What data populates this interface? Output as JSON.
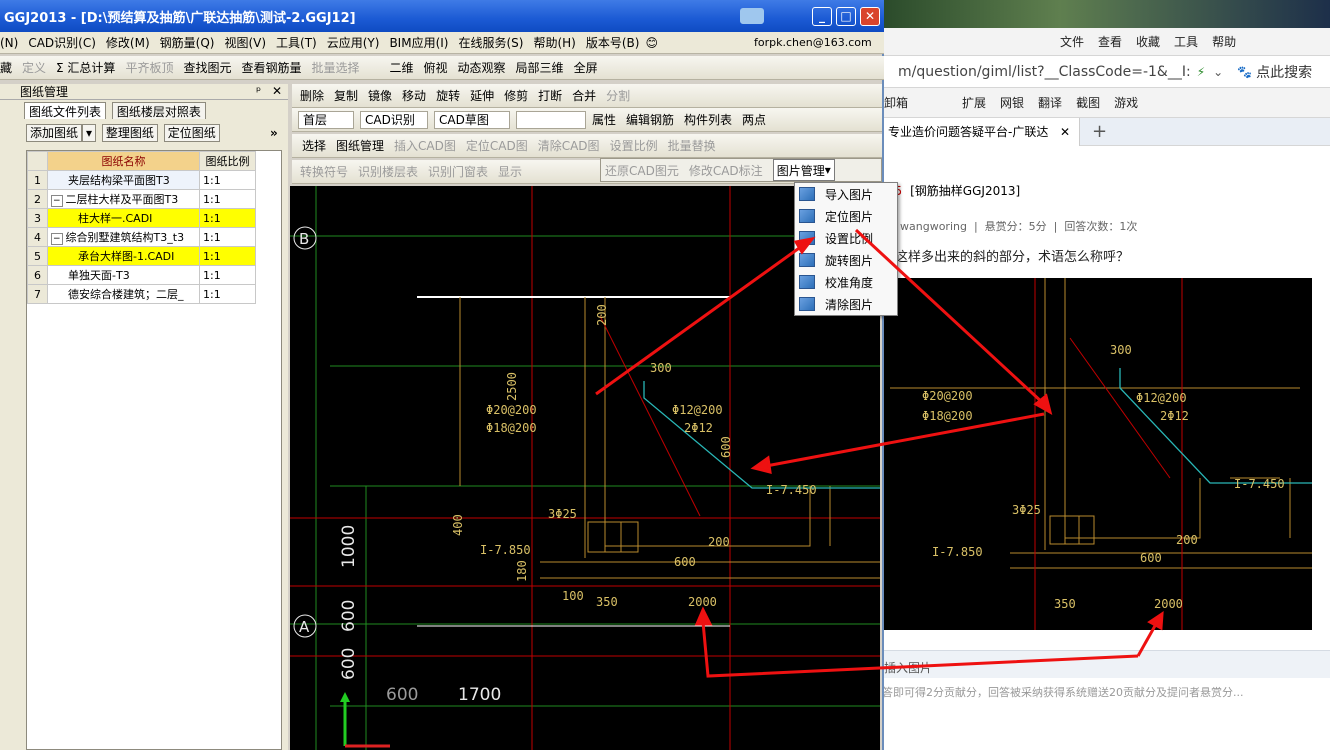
{
  "app": {
    "title": "GGJ2013 - [D:\\预结算及抽筋\\广联达抽筋\\测试-2.GGJ12]",
    "account": "forpk.chen@163.com"
  },
  "menu": [
    "(N)",
    "CAD识别(C)",
    "修改(M)",
    "钢筋量(Q)",
    "视图(V)",
    "工具(T)",
    "云应用(Y)",
    "BIM应用(I)",
    "在线服务(S)",
    "帮助(H)",
    "版本号(B)"
  ],
  "toolbar1": {
    "left": [
      "藏",
      "定义",
      "Σ 汇总计算",
      "平齐板顶",
      "查找图元",
      "查看钢筋量",
      "批量选择"
    ],
    "right": [
      "二维",
      "俯视",
      "动态观察",
      "局部三维",
      "全屏"
    ]
  },
  "toolbar2": [
    "删除",
    "复制",
    "镜像",
    "移动",
    "旋转",
    "延伸",
    "修剪",
    "打断",
    "合并",
    "分割"
  ],
  "toolbar3": {
    "floor": "首层",
    "mode": "CAD识别",
    "draft": "CAD草图",
    "blank": "",
    "buttons": [
      "属性",
      "编辑钢筋",
      "构件列表",
      "两点"
    ]
  },
  "toolbar4": [
    "选择",
    "图纸管理",
    "插入CAD图",
    "定位CAD图",
    "清除CAD图",
    "设置比例",
    "批量替换"
  ],
  "toolbar5": [
    "转换符号",
    "识别楼层表",
    "识别门窗表",
    "显示",
    "还原CAD图元",
    "修改CAD标注",
    "图片管理"
  ],
  "picture_menu": [
    "导入图片",
    "定位图片",
    "设置比例",
    "旋转图片",
    "校准角度",
    "清除图片"
  ],
  "panel": {
    "title": "图纸管理",
    "tabs": [
      "图纸文件列表",
      "图纸楼层对照表"
    ],
    "buttons": [
      "添加图纸",
      "整理图纸",
      "定位图纸"
    ],
    "columns": [
      "图纸名称",
      "图纸比例"
    ],
    "rows": [
      {
        "n": "1",
        "name": "夹层结构梁平面图T3",
        "scale": "1:1",
        "hl": false
      },
      {
        "n": "2",
        "name": "二层柱大样及平面图T3",
        "scale": "1:1",
        "hl": false
      },
      {
        "n": "3",
        "name": "柱大样一.CADI",
        "scale": "1:1",
        "hl": true
      },
      {
        "n": "4",
        "name": "综合别墅建筑结构T3_t3",
        "scale": "1:1",
        "hl": false
      },
      {
        "n": "5",
        "name": "承台大样图-1.CADI",
        "scale": "1:1",
        "hl": true
      },
      {
        "n": "6",
        "name": "单独天面-T3",
        "scale": "1:1",
        "hl": false
      },
      {
        "n": "7",
        "name": "德安综合楼建筑；二层_",
        "scale": "1:1",
        "hl": false
      }
    ]
  },
  "cad": {
    "axis_b": "B",
    "axis_a": "A",
    "dims": [
      "1000",
      "600",
      "600",
      "600",
      "1700"
    ],
    "labels": [
      "Φ20@200",
      "Φ18@200",
      "Φ12@200",
      "2Φ12",
      "300",
      "600",
      "200",
      "2500",
      "3Φ25",
      "I-7.450",
      "I-7.850",
      "400",
      "100",
      "350",
      "2000",
      "180",
      "600",
      "200"
    ]
  },
  "browser": {
    "menu": [
      "文件",
      "查看",
      "收藏",
      "工具",
      "帮助"
    ],
    "url": "m/question/giml/list?__ClassCode=-1&__I:",
    "search": "点此搜索",
    "bookmarks": [
      "卸箱",
      "扩展",
      "网银",
      "翻译",
      "截图",
      "游戏"
    ],
    "tab": "专业造价问题答疑平台-广联达",
    "crumb_num": "5",
    "crumb": "[钢筋抽样GGJ2013]",
    "meta": "wangworing  |  悬赏分：5分  |  回答次数：1次",
    "question": "是这样多出来的斜的部分，术语怎么称呼？",
    "insert": "插入图片",
    "footer": "答即可得2分贡献分，回答被采纳获得系统赠送20贡献分及提问者悬赏分..."
  }
}
